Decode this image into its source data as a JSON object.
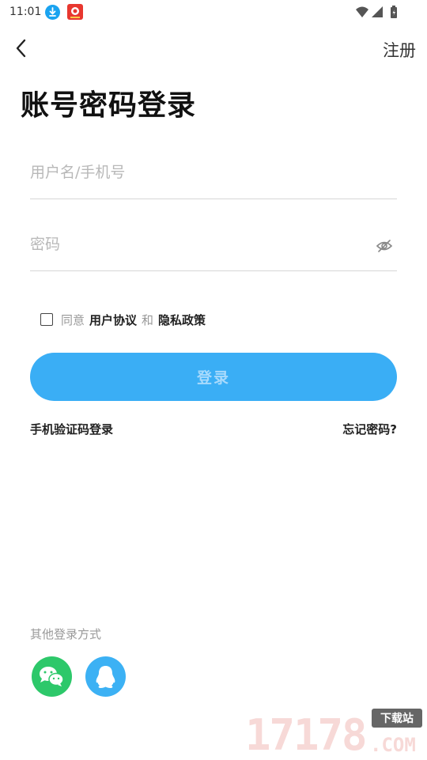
{
  "status_bar": {
    "time": "11:01"
  },
  "header": {
    "register_label": "注册"
  },
  "title": "账号密码登录",
  "form": {
    "username_placeholder": "用户名/手机号",
    "password_placeholder": "密码"
  },
  "agreement": {
    "prefix": "同意",
    "user_agreement": "用户协议",
    "and": "和",
    "privacy_policy": "隐私政策"
  },
  "login_button_label": "登录",
  "sms_login_label": "手机验证码登录",
  "forgot_password_label": "忘记密码?",
  "other_login": {
    "title": "其他登录方式",
    "options": [
      {
        "name": "wechat",
        "color": "#2dc86a"
      },
      {
        "name": "qq",
        "color": "#3cb1f4"
      }
    ]
  },
  "watermark": {
    "digits": "17178",
    "domain": ".COM",
    "badge": "下载站"
  },
  "colors": {
    "primary": "#3aaef5",
    "primary_text": "#a8dafc",
    "placeholder": "#b8b8b8",
    "muted": "#999999"
  }
}
